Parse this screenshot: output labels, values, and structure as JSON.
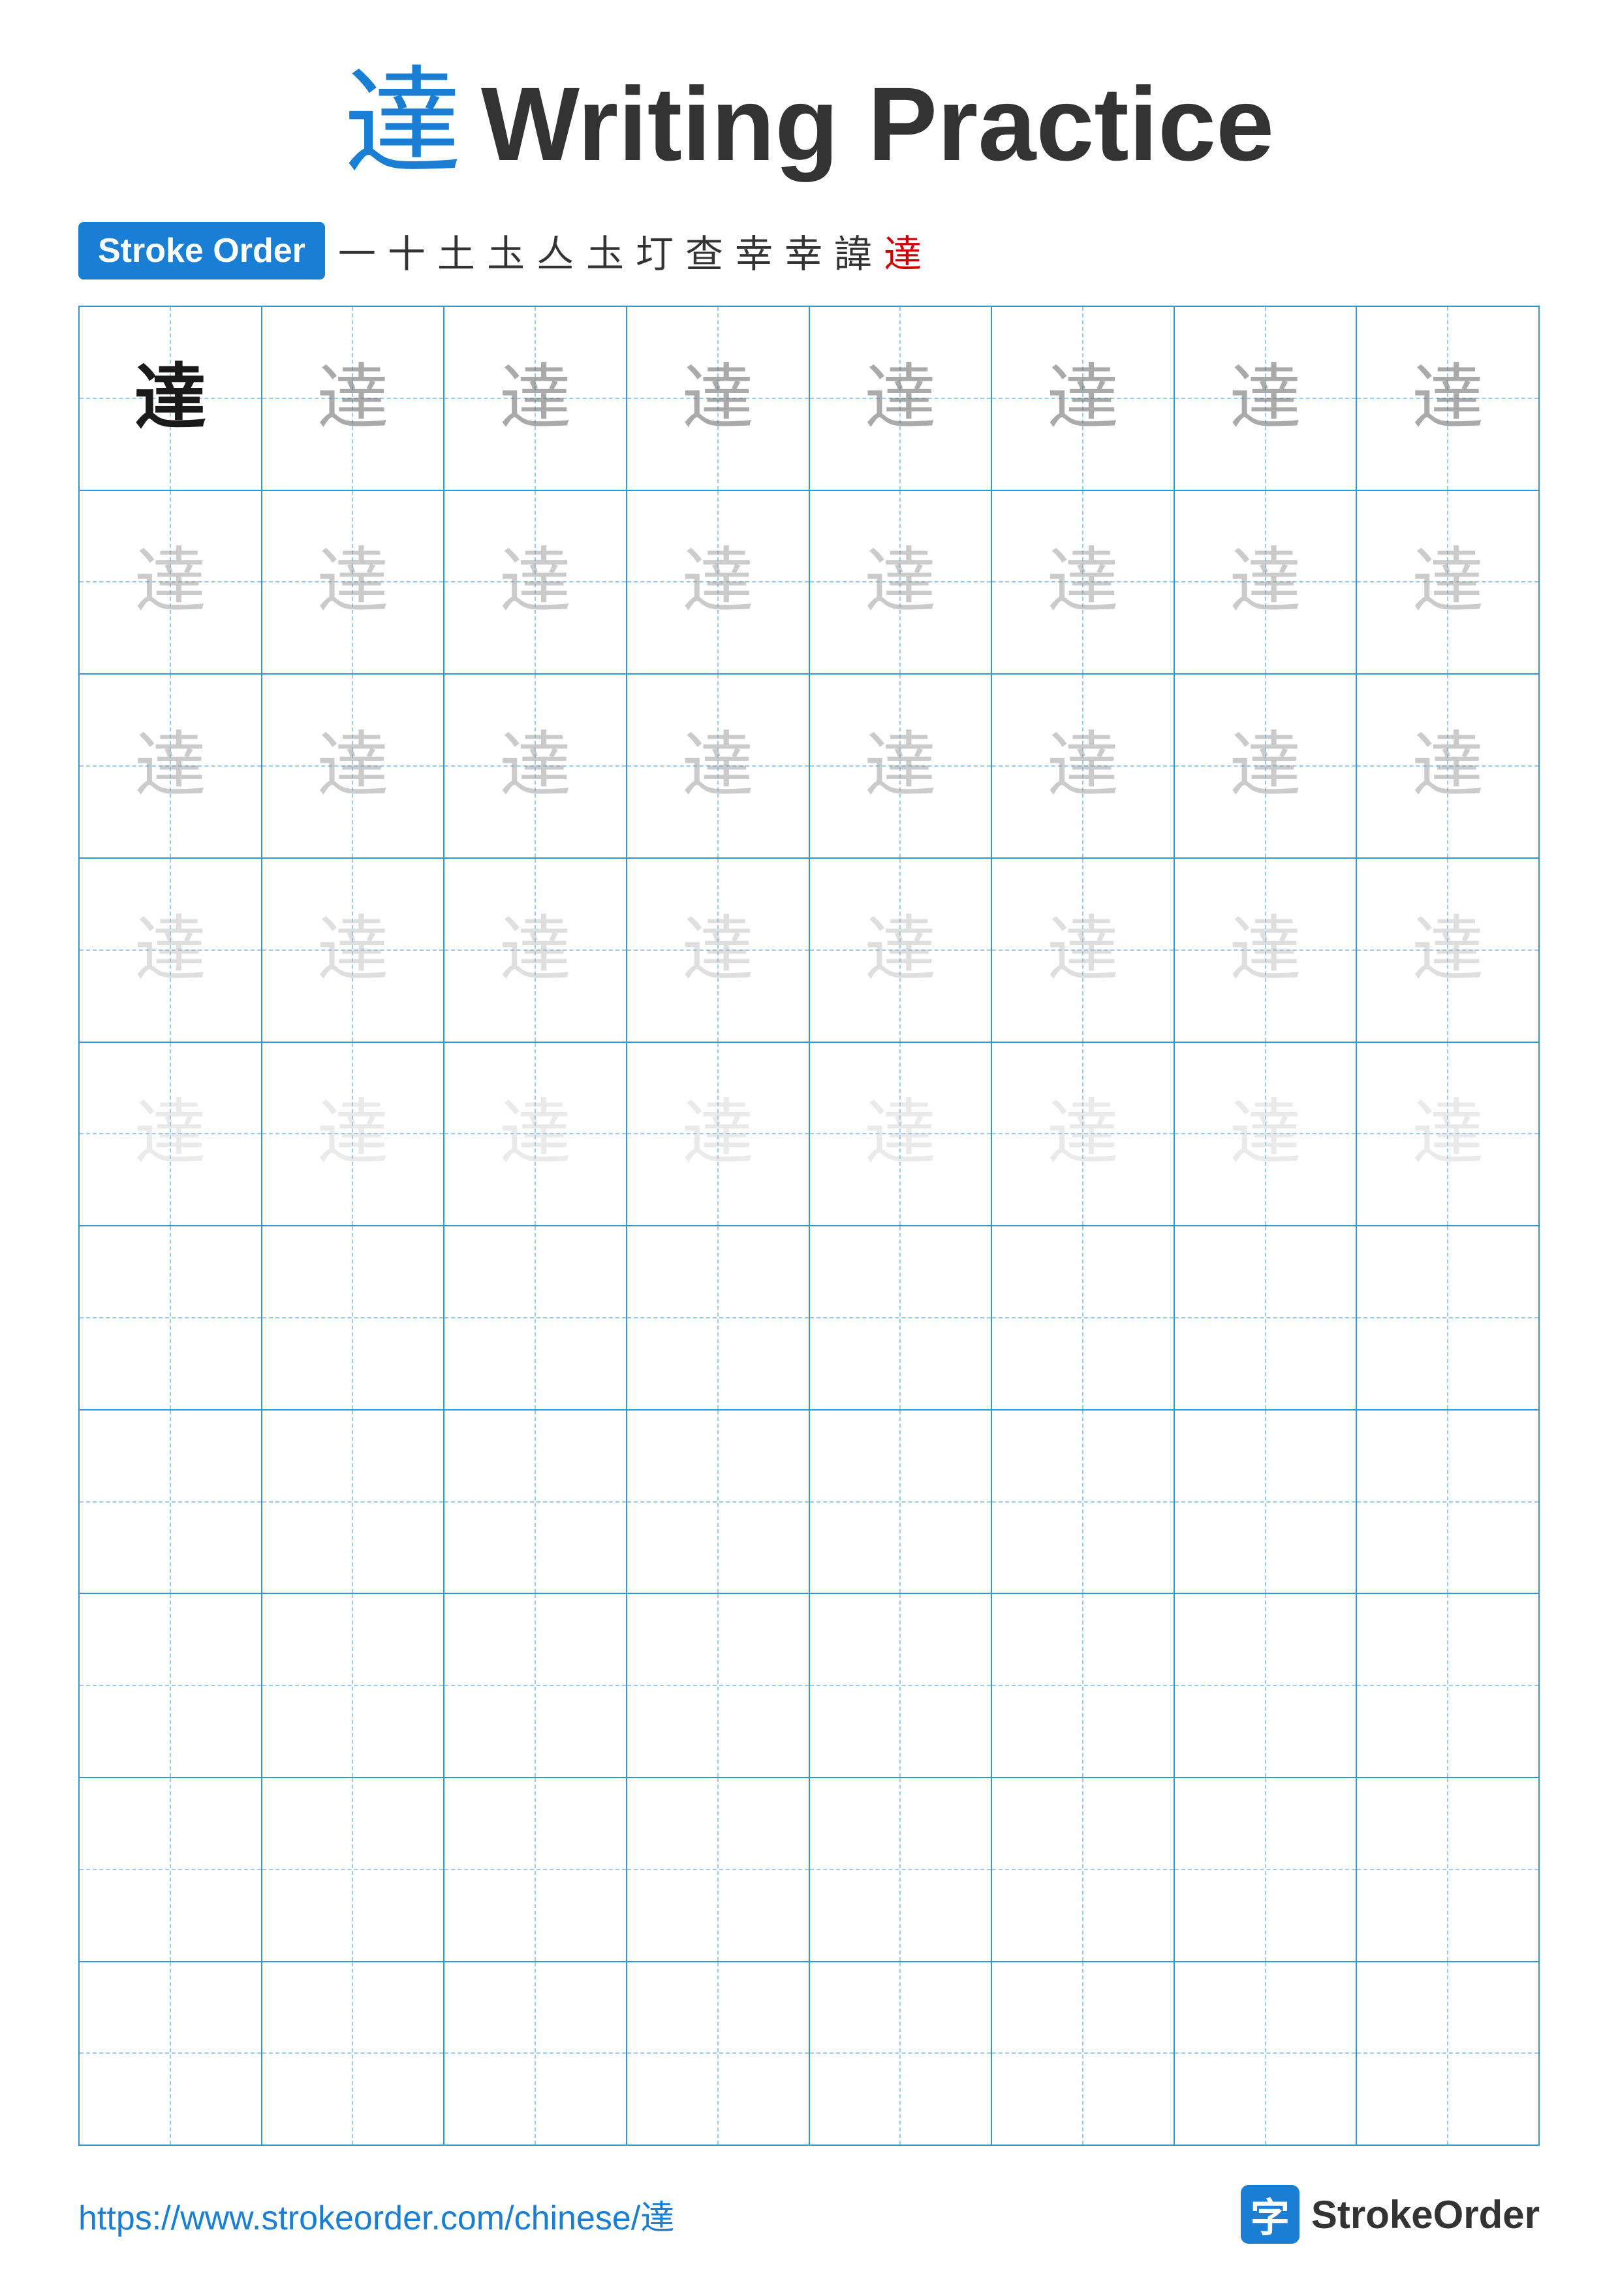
{
  "title": {
    "char": "達",
    "text": "Writing Practice"
  },
  "stroke_order": {
    "badge_label": "Stroke Order",
    "steps": [
      "一",
      "+",
      "土",
      "圡",
      "亼",
      "圡",
      "圢",
      "查",
      "幸",
      "幸",
      "諱",
      "達"
    ]
  },
  "grid": {
    "rows": 10,
    "cols": 8,
    "char": "達",
    "practice_char": "達"
  },
  "footer": {
    "url": "https://www.strokeorder.com/chinese/達",
    "logo_char": "字",
    "logo_text": "StrokeOrder"
  }
}
